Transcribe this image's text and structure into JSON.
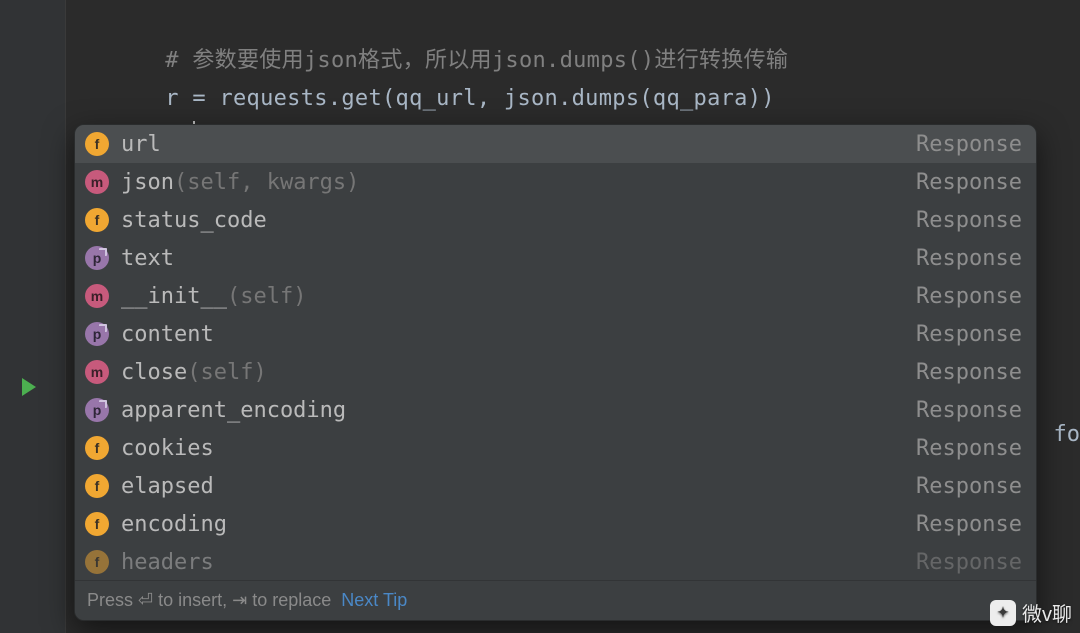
{
  "code": {
    "comment_prefix": "# ",
    "comment_text": "参数要使用json格式，所以用json.dumps()进行转换传输",
    "line2": "r = requests.get(qq_url, json.dumps(qq_para))",
    "line3_prefix": "r."
  },
  "completion": {
    "items": [
      {
        "icon": "f",
        "name": "url",
        "params": "",
        "type": "Response"
      },
      {
        "icon": "m",
        "name": "json",
        "params": "(self, kwargs)",
        "type": "Response"
      },
      {
        "icon": "f",
        "name": "status_code",
        "params": "",
        "type": "Response"
      },
      {
        "icon": "p",
        "name": "text",
        "params": "",
        "type": "Response"
      },
      {
        "icon": "m",
        "name": "__init__",
        "params": "(self)",
        "type": "Response"
      },
      {
        "icon": "p",
        "name": "content",
        "params": "",
        "type": "Response"
      },
      {
        "icon": "m",
        "name": "close",
        "params": "(self)",
        "type": "Response"
      },
      {
        "icon": "p",
        "name": "apparent_encoding",
        "params": "",
        "type": "Response"
      },
      {
        "icon": "f",
        "name": "cookies",
        "params": "",
        "type": "Response"
      },
      {
        "icon": "f",
        "name": "elapsed",
        "params": "",
        "type": "Response"
      },
      {
        "icon": "f",
        "name": "encoding",
        "params": "",
        "type": "Response"
      },
      {
        "icon": "f",
        "name": "headers",
        "params": "",
        "type": "Response"
      }
    ],
    "footer_hint": "Press ⏎ to insert, ⇥ to replace",
    "footer_link": "Next Tip"
  },
  "ghost_right": "fo",
  "watermark": "微v聊"
}
